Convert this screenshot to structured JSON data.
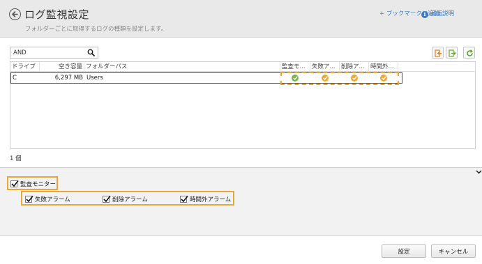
{
  "header": {
    "title": "ログ監視設定",
    "subtitle": "フォルダーごとに取得するログの種類を設定します。",
    "bookmark_label": "+ ブックマークに追加",
    "help_label": "画面説明"
  },
  "search": {
    "value": "AND",
    "placeholder": ""
  },
  "table": {
    "columns": [
      "ドライブ",
      "空き容量",
      "フォルダーパス",
      "監査モ...",
      "失敗ア...",
      "削除ア...",
      "時間外..."
    ],
    "rows": [
      {
        "drive": "C",
        "free_space": "6,297 MB",
        "path": "Users",
        "audit": "ok",
        "fail": "ok",
        "delete": "ok",
        "offhours": "ok"
      }
    ]
  },
  "count_label": "1 個",
  "checkboxes": {
    "audit_monitor": {
      "label": "監査モニター",
      "checked": true
    },
    "fail_alarm": {
      "label": "失敗アラーム",
      "checked": true
    },
    "delete_alarm": {
      "label": "削除アラーム",
      "checked": true
    },
    "offhours_alarm": {
      "label": "時間外アラーム",
      "checked": true
    }
  },
  "buttons": {
    "ok": "設定",
    "cancel": "キャンセル"
  },
  "colors": {
    "accent_orange": "#e8a73a",
    "link_blue": "#3a7bbf",
    "ok_green": "#7cb342",
    "ok_orange": "#f0a830"
  },
  "icons": [
    "back-arrow-icon",
    "info-icon",
    "search-icon",
    "import-icon",
    "export-icon",
    "refresh-icon",
    "check-circle-icon",
    "chevron-down-icon"
  ]
}
